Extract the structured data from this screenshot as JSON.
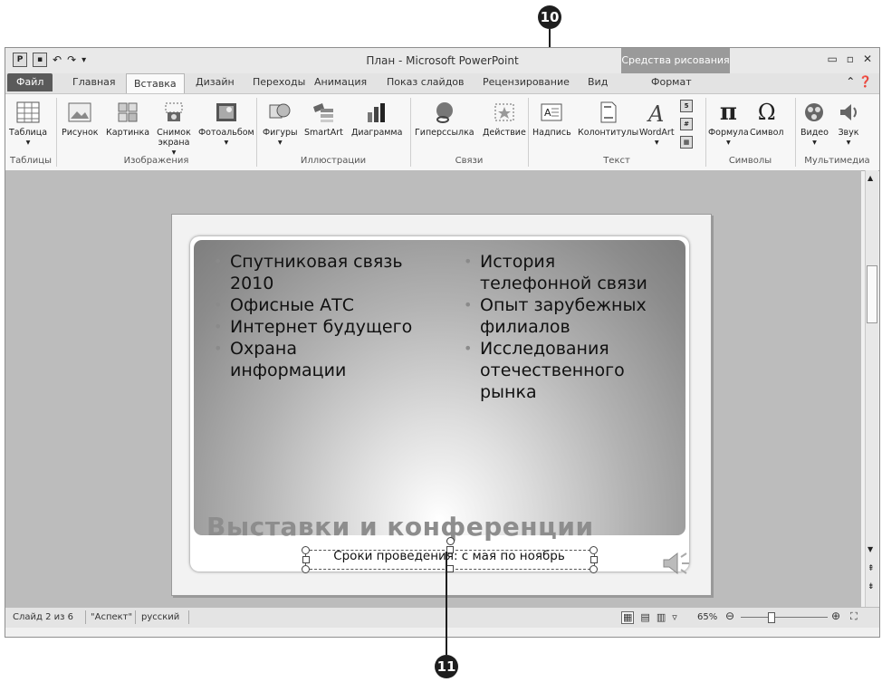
{
  "callouts": {
    "top": "10",
    "bottom": "11"
  },
  "window": {
    "title": "План - Microsoft PowerPoint",
    "context_tools": "Средства рисования",
    "buttons": {
      "minimize": "▭",
      "restore": "▫",
      "close": "✕"
    }
  },
  "tabs": [
    "Файл",
    "Главная",
    "Вставка",
    "Дизайн",
    "Переходы",
    "Анимация",
    "Показ слайдов",
    "Рецензирование",
    "Вид",
    "Формат"
  ],
  "ribbon": {
    "buttons": {
      "table": "Таблица",
      "picture": "Рисунок",
      "clipart": "Картинка",
      "screenshot": "Снимок экрана ▾",
      "album": "Фотоальбом",
      "shapes": "Фигуры",
      "smartart": "SmartArt",
      "chart": "Диаграмма",
      "hyperlink": "Гиперссылка",
      "action": "Действие",
      "textbox": "Надпись",
      "header_footer": "Колонтитулы",
      "wordart": "WordArt",
      "equation": "Формула",
      "symbol": "Символ",
      "video": "Видео",
      "audio": "Звук"
    },
    "groups": {
      "tables": "Таблицы",
      "images": "Изображения",
      "illustrations": "Иллюстрации",
      "links": "Связи",
      "text": "Текст",
      "symbols": "Символы",
      "media": "Мультимедиа"
    }
  },
  "slide": {
    "left_bullets": [
      "Спутниковая связь 2010",
      "Офисные АТС",
      "Интернет будущего",
      "Охрана информации"
    ],
    "right_bullets": [
      "История телефонной связи",
      "Опыт зарубежных филиалов",
      "Исследования отечественного рынка"
    ],
    "title": "Выставки и конференции",
    "subtitle": "Сроки проведения: с мая по ноябрь"
  },
  "status": {
    "slide": "Слайд 2 из 6",
    "theme": "\"Аспект\"",
    "language": "русский",
    "zoom": "65%"
  },
  "colors": {
    "file_tab": "#5a5a5a",
    "context_tab": "#9a9a9a"
  }
}
